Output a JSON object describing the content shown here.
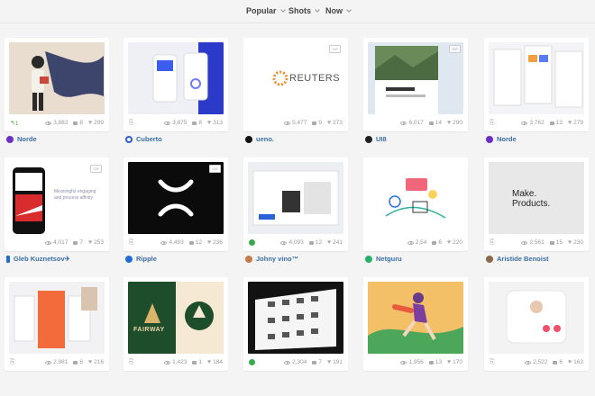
{
  "nav": {
    "popular": "Popular",
    "shots": "Shots",
    "now": "Now"
  },
  "colors": {
    "author_link": "#3a6ea5",
    "stat_gray": "#999999",
    "background": "#f4f4f4"
  },
  "shots": [
    {
      "views": "3,882",
      "comments": "8",
      "likes": "299",
      "extra": "1",
      "author": "Norde",
      "avatar_color": "#6a2ec9",
      "gif": false
    },
    {
      "views": "3,875",
      "comments": "8",
      "likes": "313",
      "extra": "",
      "author": "Cuberto",
      "avatar_color": "#2a5bd7",
      "gif": false
    },
    {
      "views": "5,477",
      "comments": "9",
      "likes": "273",
      "extra": "",
      "author": "ueno.",
      "avatar_color": "#111111",
      "gif": true,
      "gif_label": "GIF",
      "brand": "REUTERS"
    },
    {
      "views": "6,017",
      "comments": "14",
      "likes": "290",
      "extra": "",
      "author": "UI8",
      "avatar_color": "#222222",
      "gif": true,
      "gif_label": "GIF"
    },
    {
      "views": "3,762",
      "comments": "13",
      "likes": "279",
      "extra": "",
      "author": "Norde",
      "avatar_color": "#6a2ec9",
      "gif": false
    },
    {
      "views": "4,017",
      "comments": "7",
      "likes": "253",
      "extra": "",
      "author": "Gleb Kuznetsov✈",
      "avatar_color": "#1f6fd1",
      "gif": true,
      "gif_label": "GIF",
      "text": "Meaningful engaging and process affinity"
    },
    {
      "views": "4,493",
      "comments": "12",
      "likes": "236",
      "extra": "",
      "author": "Ripple",
      "avatar_color": "#1f6fd1",
      "gif": true,
      "gif_label": "GIF"
    },
    {
      "views": "4,093",
      "comments": "12",
      "likes": "241",
      "extra": "",
      "author": "Johny vino™",
      "avatar_color": "#3aa84b",
      "gif": false
    },
    {
      "views": "2,54",
      "comments": "6",
      "likes": "220",
      "extra": "",
      "author": "Netguru",
      "avatar_color": "#27b168",
      "gif": false
    },
    {
      "views": "2,561",
      "comments": "15",
      "likes": "230",
      "extra": "",
      "author": "Aristide Benoist",
      "avatar_color": "#8a6a4a",
      "gif": false,
      "text": "Make. Products."
    },
    {
      "views": "2,981",
      "comments": "6",
      "likes": "216",
      "extra": "",
      "author": "",
      "avatar_color": "#cccccc",
      "gif": false
    },
    {
      "views": "1,423",
      "comments": "1",
      "likes": "184",
      "extra": "",
      "author": "",
      "avatar_color": "#cccccc",
      "gif": false,
      "brand": "FAIRWAY"
    },
    {
      "views": "2,304",
      "comments": "7",
      "likes": "191",
      "extra": "",
      "author": "",
      "avatar_color": "#cccccc",
      "gif": false
    },
    {
      "views": "1,956",
      "comments": "13",
      "likes": "170",
      "extra": "",
      "author": "",
      "avatar_color": "#cccccc",
      "gif": false
    },
    {
      "views": "2,522",
      "comments": "6",
      "likes": "163",
      "extra": "",
      "author": "",
      "avatar_color": "#cccccc",
      "gif": false
    }
  ]
}
